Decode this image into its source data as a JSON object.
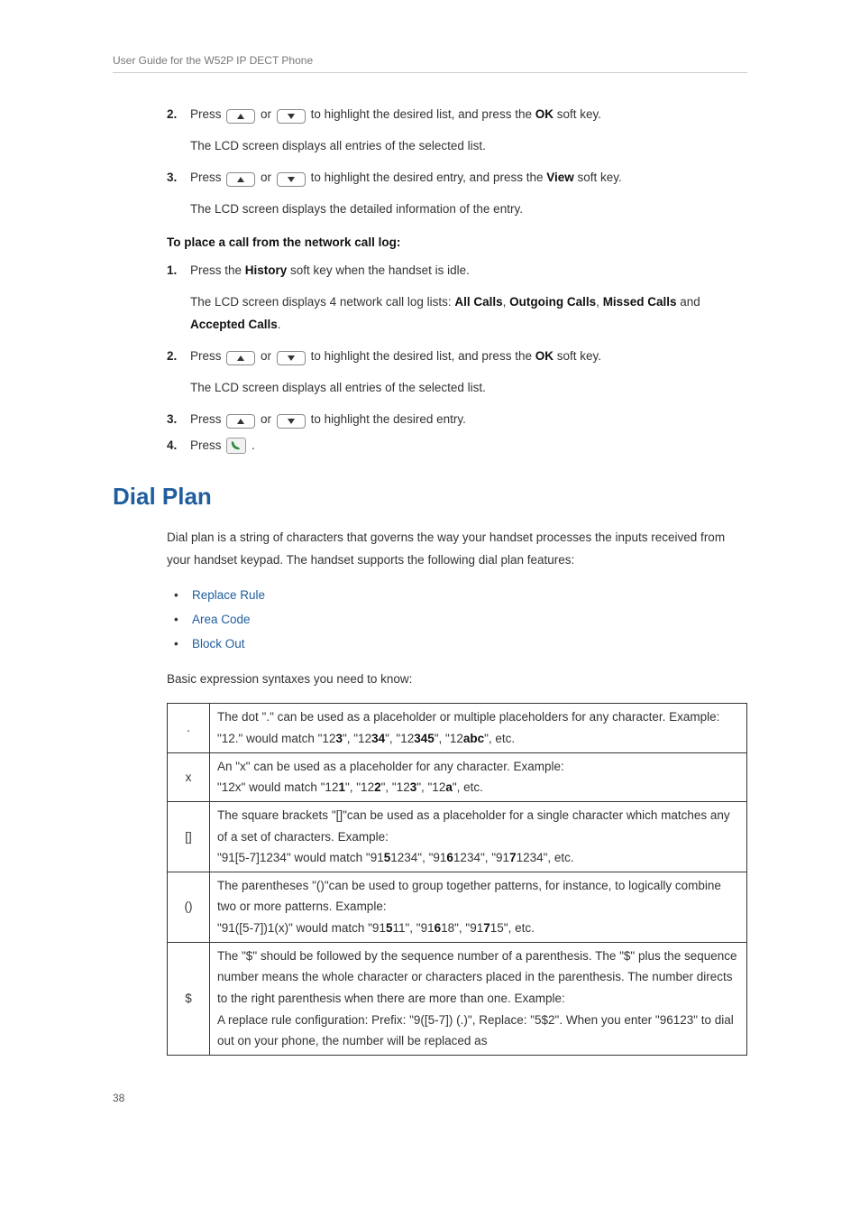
{
  "header": {
    "running_title": "User Guide for the W52P IP DECT Phone"
  },
  "steps_a": [
    {
      "n": "2.",
      "t1": "Press ",
      "t2": " or ",
      "t3": " to highlight the desired list, and press the ",
      "b": "OK",
      "t4": " soft key.",
      "sub": "The LCD screen displays all entries of the selected list."
    },
    {
      "n": "3.",
      "t1": "Press ",
      "t2": " or ",
      "t3": " to highlight the desired entry, and press the ",
      "b": "View",
      "t4": " soft key.",
      "sub": "The LCD screen displays the detailed information of the entry."
    }
  ],
  "subhead_network": "To place a call from the network call log:",
  "steps_b": [
    {
      "n": "1.",
      "pre": "Press the ",
      "b": "History",
      "post": " soft key when the handset is idle.",
      "sub_pre": "The LCD screen displays 4 network call log lists: ",
      "sub_b1": "All Calls",
      "sub_sep1": ", ",
      "sub_b2": "Outgoing Calls",
      "sub_sep2": ", ",
      "sub_b3": "Missed Calls",
      "sub_sep3": " and ",
      "sub_b4": "Accepted Calls",
      "sub_end": "."
    },
    {
      "n": "2.",
      "t1": "Press ",
      "t2": " or ",
      "t3": " to highlight the desired list, and press the ",
      "b": "OK",
      "t4": " soft key.",
      "sub": "The LCD screen displays all entries of the selected list."
    },
    {
      "n": "3.",
      "t1": "Press ",
      "t2": " or ",
      "t3": " to highlight the desired entry."
    },
    {
      "n": "4.",
      "t1": "Press ",
      "call": true,
      "t4": " ."
    }
  ],
  "section_title": "Dial Plan",
  "intro_para": "Dial plan is a string of characters that governs the way your handset processes the inputs received from your handset keypad. The handset supports the following dial plan features:",
  "bullets": [
    "Replace Rule",
    "Area Code",
    "Block Out"
  ],
  "syntax_intro": "Basic expression syntaxes you need to know:",
  "syntax": [
    {
      "sym": ".",
      "l1": "The dot \".\" can be used as a placeholder or multiple placeholders for any character. Example:",
      "l2a": "\"12.\" would match \"12",
      "l2b": "3",
      "l2c": "\", \"12",
      "l2d": "34",
      "l2e": "\", \"12",
      "l2f": "345",
      "l2g": "\", \"12",
      "l2h": "abc",
      "l2i": "\", etc."
    },
    {
      "sym": "x",
      "l1": "An \"x\" can be used as a placeholder for any character. Example:",
      "l2a": "\"12x\" would match \"12",
      "l2b": "1",
      "l2c": "\", \"12",
      "l2d": "2",
      "l2e": "\", \"12",
      "l2f": "3",
      "l2g": "\", \"12",
      "l2h": "a",
      "l2i": "\", etc."
    },
    {
      "sym": "[]",
      "l1": "The square brackets \"[]\"can be used as a placeholder for a single character which matches any of a set of characters. Example:",
      "l2a": "\"91[5-7]1234\" would match \"91",
      "l2b": "5",
      "l2c": "1234\", \"91",
      "l2d": "6",
      "l2e": "1234\", \"91",
      "l2f": "7",
      "l2g": "1234\", etc."
    },
    {
      "sym": "()",
      "l1": "The parentheses \"()\"can be used to group together patterns, for instance, to logically combine two or more patterns. Example:",
      "l2a": "\"91([5-7])1(x)\" would match \"91",
      "l2b": "5",
      "l2bb": "11",
      "l2c": "\", \"91",
      "l2d": "6",
      "l2dd": "18",
      "l2e": "\", \"91",
      "l2f": "7",
      "l2ff": "15",
      "l2g": "\", etc."
    },
    {
      "sym": "$",
      "l1": "The \"$\" should be followed by the sequence number of a parenthesis. The \"$\" plus the sequence number means the whole character or characters placed in the parenthesis. The number directs to the right parenthesis when there are more than one. Example:",
      "l2": "A replace rule configuration: Prefix: \"9([5-7]) (.)\", Replace: \"5$2\". When you enter \"96123\" to dial out on your phone, the number will be replaced as"
    }
  ],
  "page_number": "38"
}
